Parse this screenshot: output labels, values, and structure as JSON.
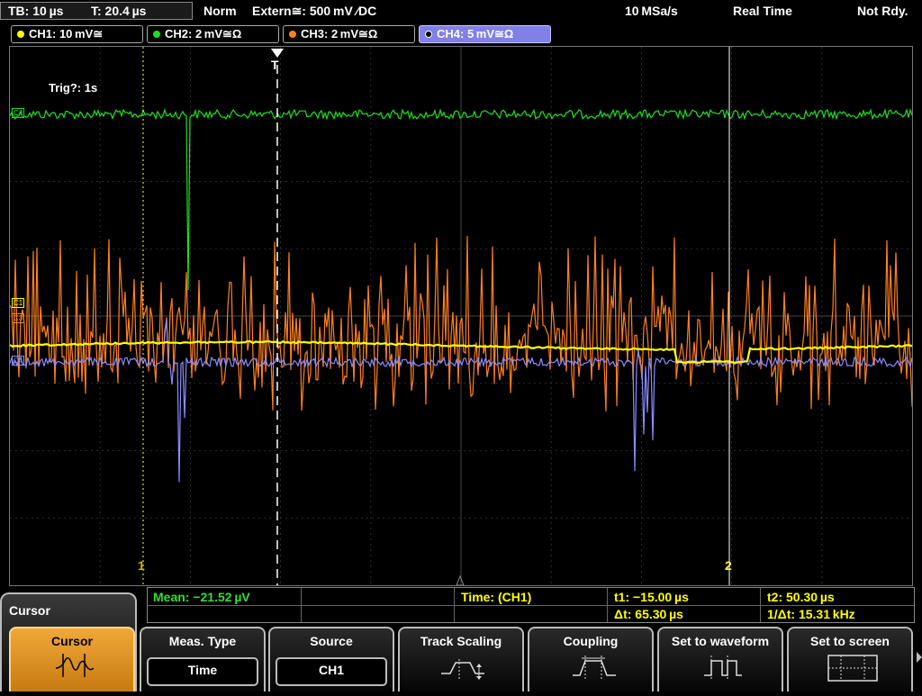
{
  "status_bar": {
    "timebase": "TB: 10 µs",
    "trig_time": "T: 20.4 µs",
    "mode": "Norm",
    "trigger": "Extern≅: 500 mV ∕DC",
    "sample_rate": "10 MSa/s",
    "acq_mode": "Real Time",
    "state": "Not Rdy."
  },
  "channels": [
    {
      "label": "CH1: 10 mV≅",
      "color": "#ffff00",
      "active": false
    },
    {
      "label": "CH2: 2 mV≅Ω",
      "color": "#22dd22",
      "active": false
    },
    {
      "label": "CH3: 2 mV≅Ω",
      "color": "#ff8020",
      "active": false
    },
    {
      "label": "CH4: 5 mV≅Ω",
      "color": "#9090ff",
      "active": true
    }
  ],
  "screen": {
    "trig_status": "Trig?: 1s",
    "trigger_marker": "T",
    "cursor1_label": "1",
    "cursor2_label": "2",
    "ch_markers": [
      "C4",
      "C1",
      "C3",
      "C4"
    ],
    "colors": {
      "ch1": "#ffff00",
      "ch2": "#22dd22",
      "ch3": "#ff8020",
      "ch4": "#8c8cff",
      "grid": "#3a3a3a"
    }
  },
  "measurement": {
    "mean": "Mean: −21.52 µV",
    "time": "Time:  (CH1)",
    "t1": "t1: −15.00 µs",
    "t2": "t2: 50.30 µs",
    "dt": "Δt: 65.30 µs",
    "inv_dt": "1/Δt: 15.31 kHz"
  },
  "menu": {
    "title": "Cursor",
    "softkeys": [
      {
        "label": "Cursor",
        "sub": "",
        "icon": "cursor-waveform-icon"
      },
      {
        "label": "Meas. Type",
        "sub": "Time",
        "icon": ""
      },
      {
        "label": "Source",
        "sub": "CH1",
        "icon": ""
      },
      {
        "label": "Track Scaling",
        "sub": "",
        "icon": "track-scaling-icon"
      },
      {
        "label": "Coupling",
        "sub": "",
        "icon": "coupling-icon"
      },
      {
        "label": "Set to waveform",
        "sub": "",
        "icon": "set-to-waveform-icon"
      },
      {
        "label": "Set to screen",
        "sub": "",
        "icon": "set-to-screen-icon"
      }
    ]
  }
}
